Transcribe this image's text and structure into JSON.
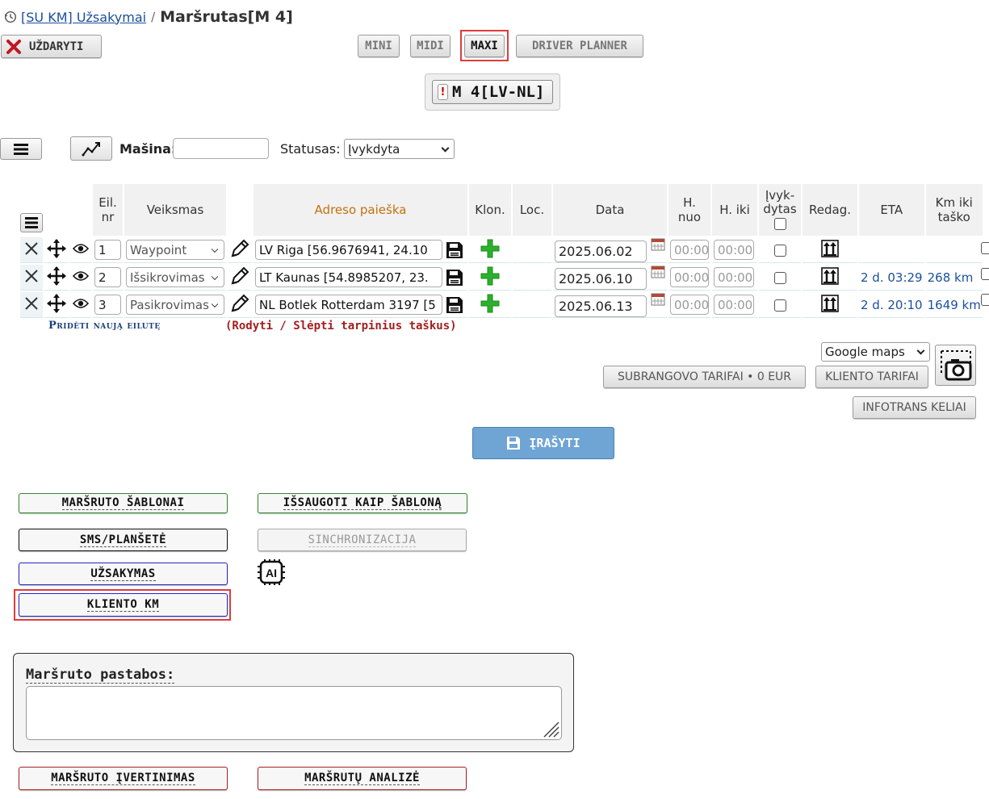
{
  "breadcrumb": {
    "parent": "[SU KM] Užsakymai",
    "separator": "/",
    "title": "Maršrutas[M 4]"
  },
  "toolbar": {
    "close_label": "UŽDARYTI",
    "views": [
      "MINI",
      "MIDI",
      "MAXI",
      "DRIVER PLANNER"
    ],
    "active_view": "MAXI"
  },
  "route_chip": {
    "label": "M 4[LV-NL]",
    "flag": "!"
  },
  "filters": {
    "masina_label": "Mašina:",
    "masina_value": "",
    "status_label": "Statusas:",
    "status_value": "Įvykdyta"
  },
  "table": {
    "headers": {
      "eil": "Eil. nr",
      "veiksmas": "Veiksmas",
      "adreso": "Adreso paieška",
      "klon": "Klon.",
      "loc": "Loc.",
      "data": "Data",
      "h_nuo": "H. nuo",
      "h_iki": "H. iki",
      "ivykdytas": "Įvyk-dytas",
      "redag": "Redag.",
      "eta": "ETA",
      "km": "Km iki taško"
    },
    "rows": [
      {
        "nr": "1",
        "action": "Waypoint",
        "address": "LV  Riga  [56.9676941, 24.10",
        "date": "2025.06.02",
        "h_from": "00:00",
        "h_to": "00:00",
        "eta": "",
        "km": ""
      },
      {
        "nr": "2",
        "action": "Išsikrovimas",
        "address": "LT  Kaunas  [54.8985207, 23.",
        "date": "2025.06.10",
        "h_from": "00:00",
        "h_to": "00:00",
        "eta": "2 d. 03:29",
        "km": "268 km"
      },
      {
        "nr": "3",
        "action": "Pasikrovimas",
        "address": "NL  Botlek Rotterdam 3197 [5",
        "date": "2025.06.13",
        "h_from": "00:00",
        "h_to": "00:00",
        "eta": "2 d. 20:10",
        "km": "1649 km"
      }
    ]
  },
  "links": {
    "add_row": "Pridėti naują eilutę",
    "toggle_points": "(Rodyti / Slėpti tarpinius taškus)"
  },
  "map_controls": {
    "map_select": "Google maps",
    "subcontractor": "SUBRANGOVO TARIFAI • 0 EUR",
    "client_tariffs": "KLIENTO TARIFAI",
    "infotrans": "INFOTRANS KELIAI"
  },
  "save_label": "ĮRAŠYTI",
  "actions": {
    "templates": "MARŠRUTO ŠABLONAI",
    "save_template": "IŠSAUGOTI KAIP ŠABLONĄ",
    "sms": "SMS/PLANŠETĖ",
    "sync": "SINCHRONIZACIJA",
    "order": "UŽSAKYMAS",
    "client_km": "KLIENTO KM",
    "evaluation": "MARŠRUTO ĮVERTINIMAS",
    "analysis": "MARŠRUTŲ ANALIZĖ"
  },
  "notes": {
    "title": "Maršruto pastabos:",
    "value": ""
  },
  "colors": {
    "accent_blue": "#6fa5d4",
    "green_plus": "#2db02d",
    "highlight_red": "#e03b3b",
    "link_blue": "#1a4f9b"
  }
}
